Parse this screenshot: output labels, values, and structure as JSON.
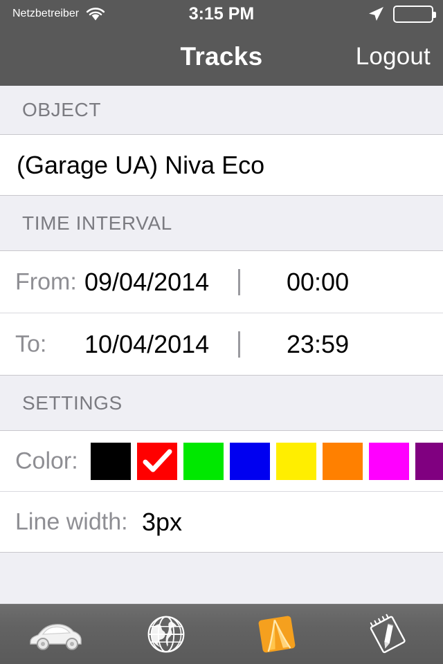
{
  "statusbar": {
    "carrier": "Netzbetreiber",
    "wifi_icon": "wifi-icon",
    "time": "3:15 PM",
    "location_icon": "location-arrow-icon",
    "battery_icon": "battery-icon"
  },
  "navbar": {
    "title": "Tracks",
    "logout_label": "Logout"
  },
  "sections": {
    "object": {
      "header": "OBJECT",
      "value": "(Garage UA) Niva Eco"
    },
    "time_interval": {
      "header": "TIME INTERVAL",
      "separator": "|",
      "rows": [
        {
          "label": "From:",
          "date": "09/04/2014",
          "time": "00:00"
        },
        {
          "label": "To:",
          "date": "10/04/2014",
          "time": "23:59"
        }
      ]
    },
    "settings": {
      "header": "SETTINGS",
      "color_label": "Color:",
      "colors": [
        {
          "name": "black",
          "hex": "#000000",
          "selected": false
        },
        {
          "name": "red",
          "hex": "#FF0000",
          "selected": true
        },
        {
          "name": "green",
          "hex": "#00E800",
          "selected": false
        },
        {
          "name": "blue",
          "hex": "#0000F0",
          "selected": false
        },
        {
          "name": "yellow",
          "hex": "#FFEE00",
          "selected": false
        },
        {
          "name": "orange",
          "hex": "#FF8000",
          "selected": false
        },
        {
          "name": "magenta",
          "hex": "#FF00FF",
          "selected": false
        },
        {
          "name": "purple",
          "hex": "#800080",
          "selected": false
        }
      ],
      "line_width_label": "Line width:",
      "line_width_value": "3px"
    }
  },
  "tabbar": {
    "items": [
      {
        "name": "car-icon",
        "active": false
      },
      {
        "name": "globe-icon",
        "active": false
      },
      {
        "name": "tracks-icon",
        "active": true
      },
      {
        "name": "reports-icon",
        "active": false
      }
    ],
    "active_color": "#F5A01E"
  }
}
